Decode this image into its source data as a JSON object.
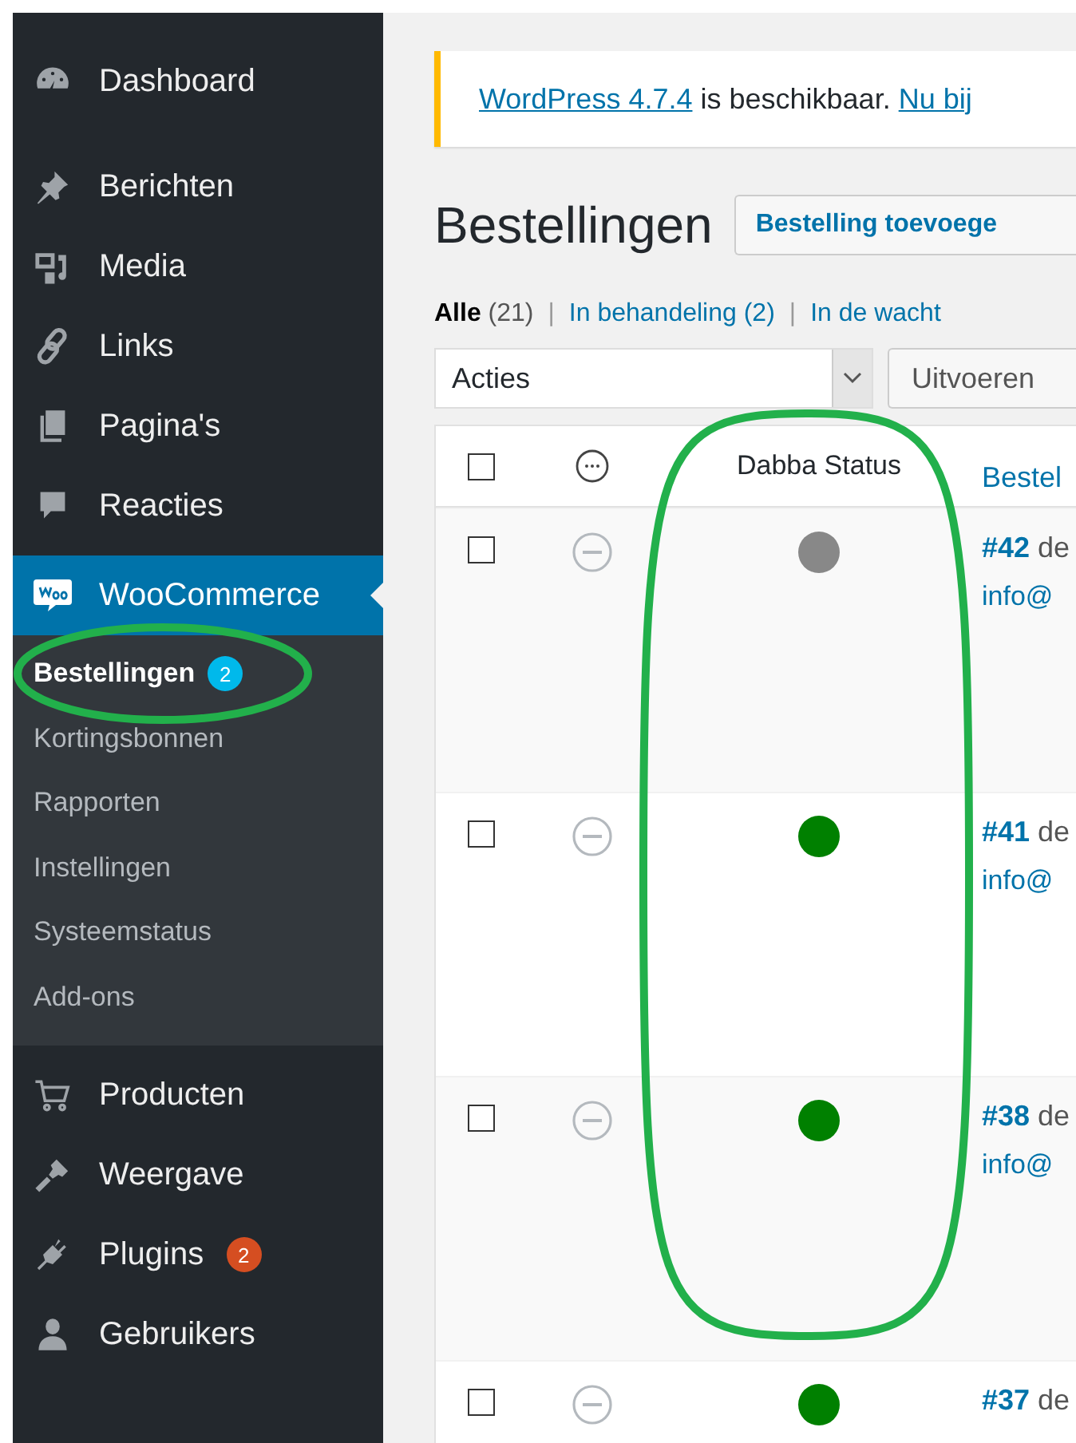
{
  "sidebar": {
    "items": [
      {
        "label": "Dashboard",
        "selected": false
      },
      {
        "label": "Berichten",
        "selected": false
      },
      {
        "label": "Media",
        "selected": false
      },
      {
        "label": "Links",
        "selected": false
      },
      {
        "label": "Pagina's",
        "selected": false
      },
      {
        "label": "Reacties",
        "selected": false
      },
      {
        "label": "WooCommerce",
        "selected": true,
        "children": [
          {
            "label": "Bestellingen",
            "badge": "2",
            "selected": true
          },
          {
            "label": "Kortingsbonnen",
            "selected": false
          },
          {
            "label": "Rapporten",
            "selected": false
          },
          {
            "label": "Instellingen",
            "selected": false
          },
          {
            "label": "Systeemstatus",
            "selected": false
          },
          {
            "label": "Add-ons",
            "selected": false
          }
        ]
      },
      {
        "label": "Producten",
        "selected": false
      },
      {
        "label": "Weergave",
        "selected": false
      },
      {
        "label": "Plugins",
        "badge": "2",
        "selected": false
      },
      {
        "label": "Gebruikers",
        "selected": false
      }
    ]
  },
  "notice": {
    "link": "WordPress 4.7.4",
    "text": "is beschikbaar.",
    "action": "Nu bij"
  },
  "page_title": "Bestellingen",
  "add_button": "Bestelling toevoege",
  "filters": [
    {
      "label": "Alle",
      "count": "(21)",
      "selected": true
    },
    {
      "separator": "|",
      "label": "In behandeling",
      "count": "(2)",
      "selected": false
    },
    {
      "separator": "|",
      "label": "In de wacht",
      "selected": false
    }
  ],
  "bulk_action": {
    "value": "Acties",
    "button": "Uitvoeren"
  },
  "table": {
    "columns": [
      {
        "kind": "checkbox",
        "checked": false
      },
      {
        "kind": "icon"
      },
      {
        "kind": "text",
        "label": "Dabba Status"
      },
      {
        "kind": "link",
        "label": "Bestel"
      }
    ],
    "rows": [
      {
        "checked": false,
        "color": "#888888",
        "order": "#42",
        "order_suffix": "de",
        "email": "info@"
      },
      {
        "checked": false,
        "color": "#008000",
        "order": "#41",
        "order_suffix": "de",
        "email": "info@"
      },
      {
        "checked": false,
        "color": "#008000",
        "order": "#38",
        "order_suffix": "de",
        "email": "info@"
      },
      {
        "checked": false,
        "color": "#008000",
        "order": "#37",
        "order_suffix": "de"
      }
    ]
  },
  "annotations": [
    {
      "kind": "ellipse",
      "color": "#22b04b"
    },
    {
      "kind": "ellipse",
      "color": "#22b04b"
    }
  ]
}
